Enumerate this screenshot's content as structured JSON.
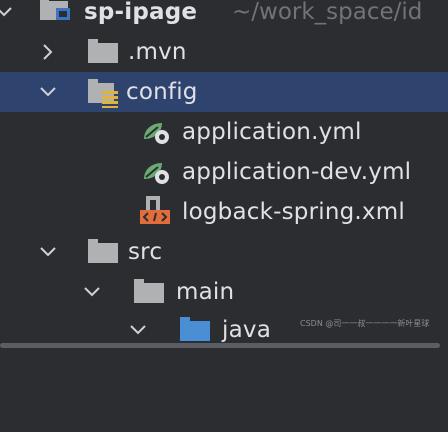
{
  "project": {
    "name": "sp-ipage",
    "path": "~/work_space/id"
  },
  "tree": {
    "mvn": {
      "label": ".mvn",
      "icon": "folder-icon"
    },
    "config": {
      "label": "config",
      "icon": "resources-folder-icon",
      "selected": true
    },
    "application_yml": {
      "label": "application.yml",
      "icon": "spring-config-icon"
    },
    "application_dev_yml": {
      "label": "application-dev.yml",
      "icon": "spring-config-icon"
    },
    "logback_xml": {
      "label": "logback-spring.xml",
      "icon": "xml-file-icon"
    },
    "src": {
      "label": "src",
      "icon": "folder-icon"
    },
    "main": {
      "label": "main",
      "icon": "folder-icon"
    },
    "java": {
      "label": "java",
      "icon": "source-folder-icon"
    }
  },
  "watermark": "CSDN @司一一叔一一一一新叶星球",
  "colors": {
    "background": "#2b2d30",
    "selection": "#2e436e",
    "text": "#dfe1e5",
    "muted": "#6f737a",
    "folder": "#afb1b3",
    "spring": "#6aab73"
  }
}
